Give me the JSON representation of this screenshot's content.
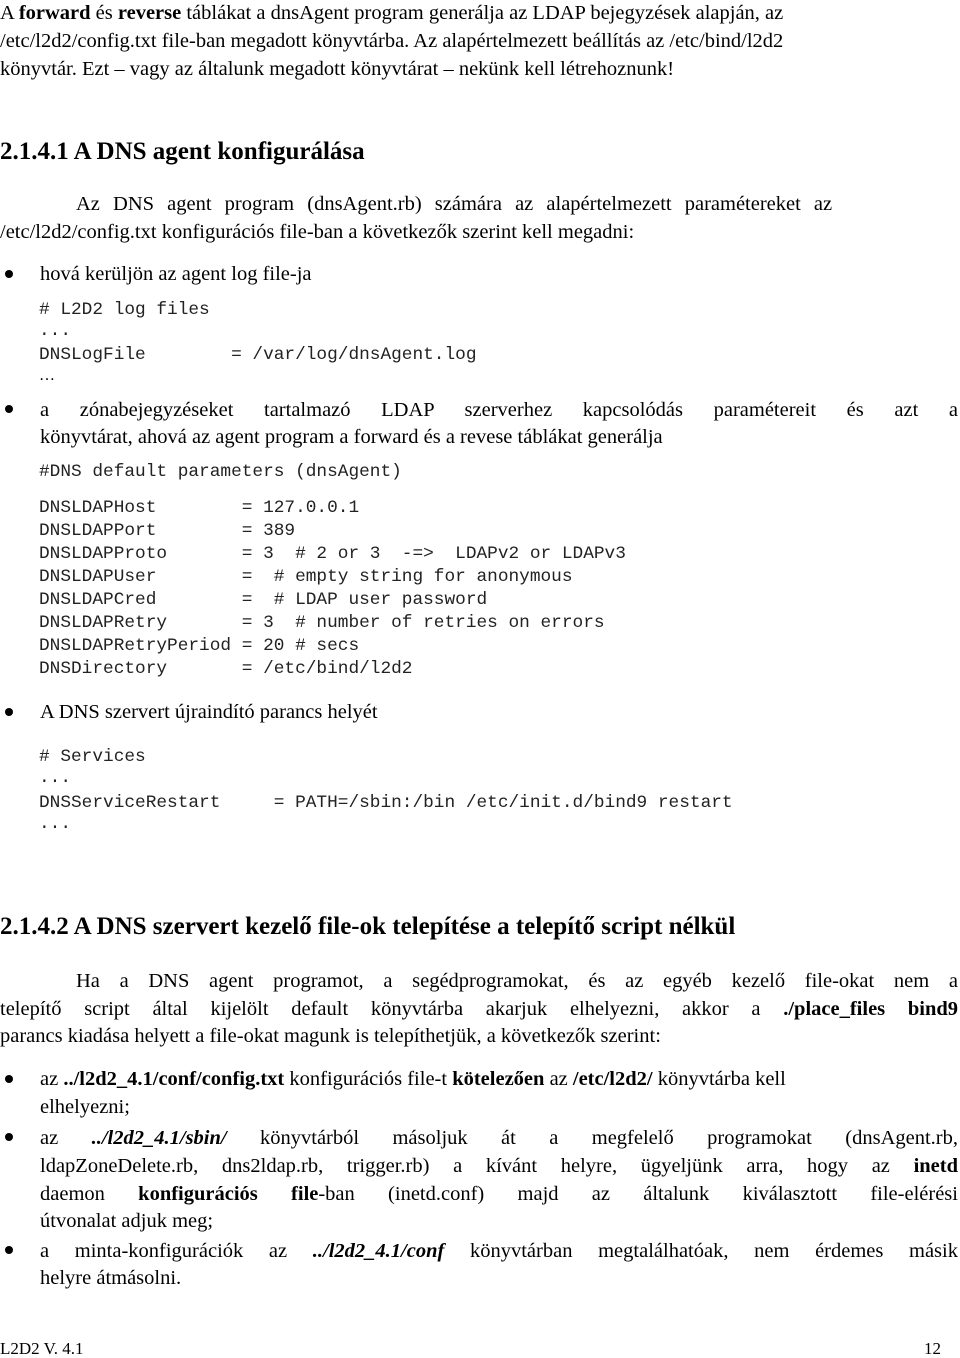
{
  "intro": {
    "line1": {
      "p1": "A ",
      "b1": "forward",
      "p2": " és ",
      "b2": "reverse",
      "p3": " táblákat a dnsAgent program generálja az LDAP bejegyzések alapján, az"
    },
    "line2": "/etc/l2d2/config.txt file-ban  megadott könyvtárba. Az alapértelmezett beállítás az /etc/bind/l2d2",
    "line3": "könyvtár. Ezt – vagy az általunk megadott könyvtárat – nekünk kell létrehoznunk!"
  },
  "section1": {
    "heading": "2.1.4.1 A DNS agent konfigurálása",
    "para_line1": "Az DNS agent program (dnsAgent.rb) számára az alapértelmezett paramétereket az",
    "para_line2": "/etc/l2d2/config.txt  konfigurációs file-ban a következők szerint kell megadni:",
    "bullet1": {
      "text": "hová kerüljön az agent log file-ja",
      "code": [
        "# L2D2 log files",
        "...",
        "DNSLogFile        = /var/log/dnsAgent.log"
      ],
      "ellipsis": "…"
    },
    "bullet2": {
      "line1": "a zónabejegyzéseket tartalmazó LDAP szerverhez kapcsolódás paramétereit és azt a",
      "line2": "könyvtárat, ahová az agent program a forward és a revese táblákat generálja",
      "code_header": "#DNS default parameters (dnsAgent)",
      "code": [
        "DNSLDAPHost        = 127.0.0.1",
        "DNSLDAPPort        = 389",
        "DNSLDAPProto       = 3  # 2 or 3  -=>  LDAPv2 or LDAPv3",
        "DNSLDAPUser        =  # empty string for anonymous",
        "DNSLDAPCred        =  # LDAP user password",
        "DNSLDAPRetry       = 3  # number of retries on errors",
        "DNSLDAPRetryPeriod = 20 # secs",
        "DNSDirectory       = /etc/bind/l2d2"
      ]
    },
    "bullet3": {
      "text": "A DNS szervert újraindító parancs helyét",
      "code": [
        "# Services",
        "...",
        "DNSServiceRestart     = PATH=/sbin:/bin /etc/init.d/bind9 restart",
        "..."
      ]
    }
  },
  "section2": {
    "heading": "2.1.4.2  A DNS szervert kezelő file-ok telepítése a telepítő script nélkül",
    "para_line1": "Ha a DNS agent programot, a segédprogramokat, és az egyéb kezelő file-okat nem a",
    "para_line2": {
      "p1": "telepítő script által kijelölt default könyvtárba akarjuk elhelyezni, akkor a ",
      "b1": "./place_files bind9"
    },
    "para_line3": "parancs kiadása helyett a file-okat magunk is telepíthetjük, a következők szerint:",
    "bullet1": {
      "p1": "az ",
      "b1": "../l2d2_4.1/conf/config.txt",
      "p2": " konfigurációs file-t ",
      "b2": "kötelezően",
      "p3": " az ",
      "b3": "/etc/l2d2/",
      "p4": " könyvtárba kell",
      "line2": "elhelyezni;"
    },
    "bullet2": {
      "line1": {
        "p1": "az ",
        "bi1": "../l2d2_4.1/sbin/",
        "p2": " könyvtárból másoljuk át a megfelelő programokat (dnsAgent.rb,"
      },
      "line2": {
        "p1": "ldapZoneDelete.rb, dns2ldap.rb, trigger.rb) a kívánt helyre, ügyeljünk arra, hogy az ",
        "b1": "inetd"
      },
      "line3": {
        "p1": "daemon ",
        "b1": "konfigurációs file",
        "p2": "-ban (inetd.conf) majd az általunk kiválasztott file-elérési"
      },
      "line4": "útvonalat adjuk meg;"
    },
    "bullet3": {
      "line1": {
        "p1": "a minta-konfigurációk az ",
        "bi1": "../l2d2_4.1/conf",
        "p2": "  könyvtárban megtalálhatóak, nem érdemes másik"
      },
      "line2": "helyre átmásolni."
    }
  },
  "footer": {
    "left": "L2D2 V. 4.1",
    "right": "12"
  }
}
